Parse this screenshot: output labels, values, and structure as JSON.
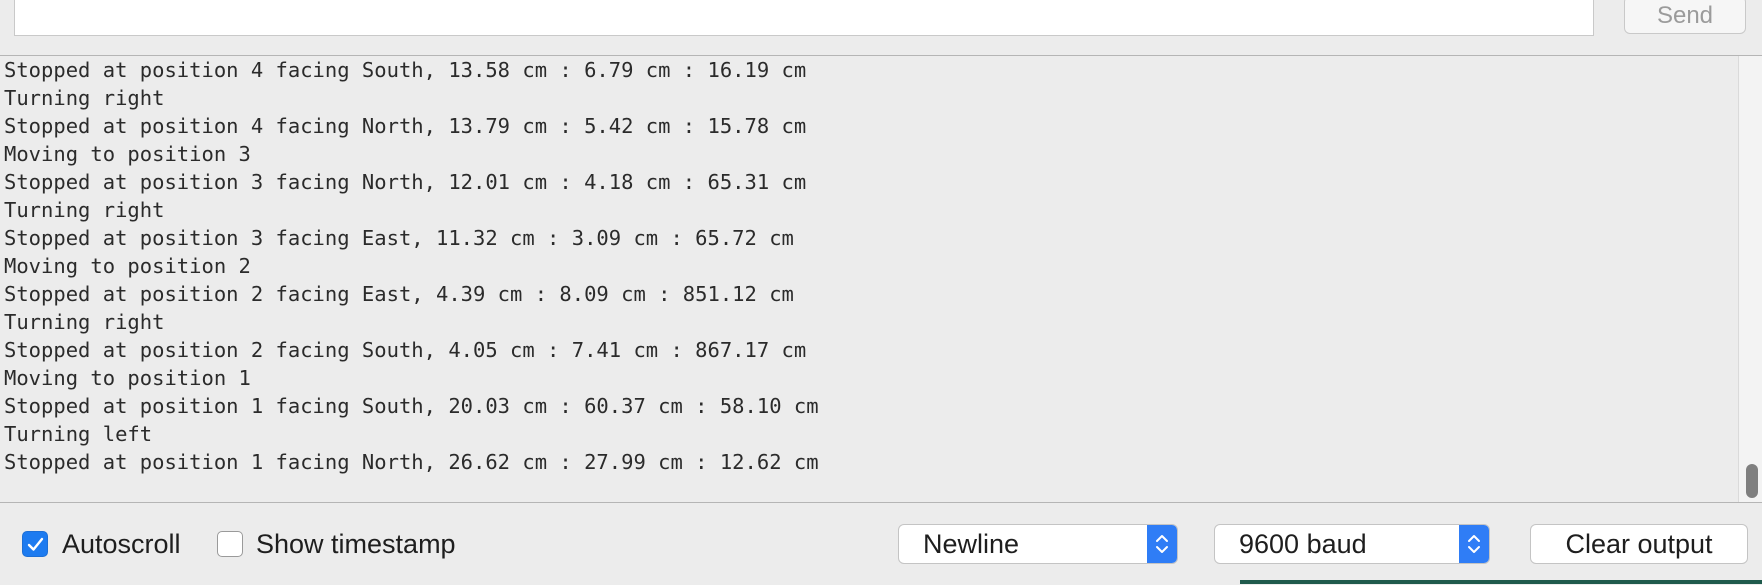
{
  "send_panel": {
    "input_value": "",
    "send_label": "Send"
  },
  "output": {
    "lines": [
      "Stopped at position 4 facing South, 13.58 cm : 6.79 cm : 16.19 cm",
      "Turning right",
      "Stopped at position 4 facing North, 13.79 cm : 5.42 cm : 15.78 cm",
      "Moving to position 3",
      "Stopped at position 3 facing North, 12.01 cm : 4.18 cm : 65.31 cm",
      "Turning right",
      "Stopped at position 3 facing East, 11.32 cm : 3.09 cm : 65.72 cm",
      "Moving to position 2",
      "Stopped at position 2 facing East, 4.39 cm : 8.09 cm : 851.12 cm",
      "Turning right",
      "Stopped at position 2 facing South, 4.05 cm : 7.41 cm : 867.17 cm",
      "Moving to position 1",
      "Stopped at position 1 facing South, 20.03 cm : 60.37 cm : 58.10 cm",
      "Turning left",
      "Stopped at position 1 facing North, 26.62 cm : 27.99 cm : 12.62 cm"
    ]
  },
  "footer": {
    "autoscroll_label": "Autoscroll",
    "autoscroll_checked": true,
    "timestamp_label": "Show timestamp",
    "timestamp_checked": false,
    "line_ending": "Newline",
    "baud_rate": "9600 baud",
    "clear_label": "Clear output"
  },
  "colors": {
    "accent": "#1d7bf0",
    "background": "#ececec"
  }
}
